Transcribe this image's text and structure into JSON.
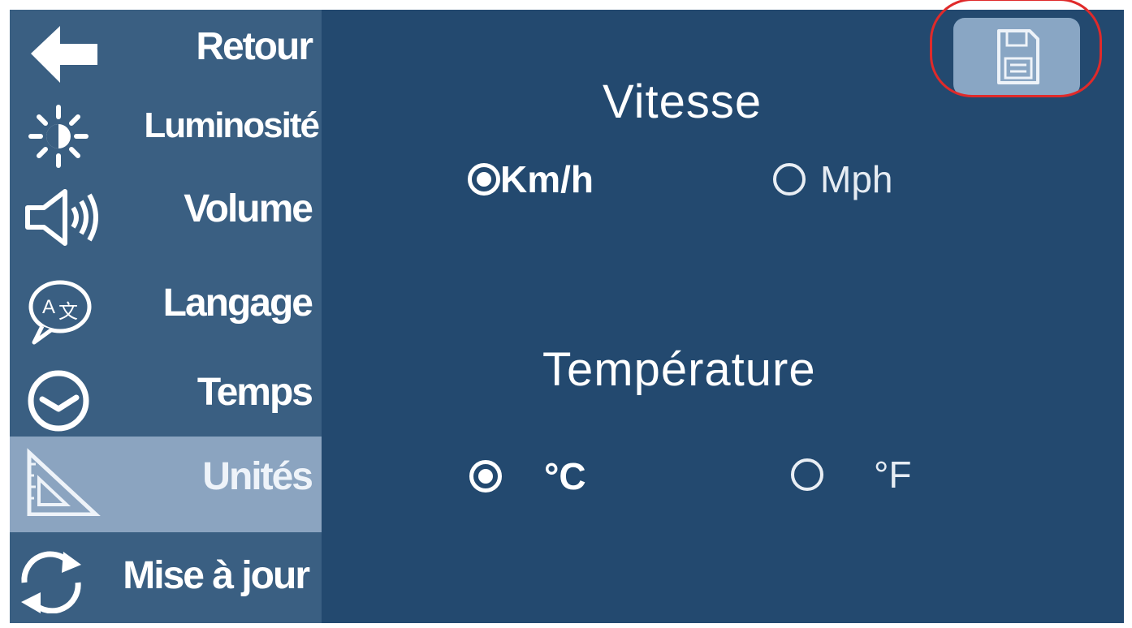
{
  "sidebar": {
    "items": [
      {
        "label": "Retour",
        "icon": "arrow-left-icon",
        "active": false
      },
      {
        "label": "Luminosité",
        "icon": "brightness-icon",
        "active": false
      },
      {
        "label": "Volume",
        "icon": "speaker-icon",
        "active": false
      },
      {
        "label": "Langage",
        "icon": "language-icon",
        "active": false
      },
      {
        "label": "Temps",
        "icon": "clock-icon",
        "active": false
      },
      {
        "label": "Unités",
        "icon": "triangle-ruler-icon",
        "active": true
      },
      {
        "label": "Mise à jour",
        "icon": "refresh-icon",
        "active": false
      }
    ]
  },
  "main": {
    "speed": {
      "title": "Vitesse",
      "options": [
        {
          "label": "Km/h",
          "selected": true
        },
        {
          "label": "Mph",
          "selected": false
        }
      ]
    },
    "temperature": {
      "title": "Température",
      "options": [
        {
          "label": "°C",
          "selected": true
        },
        {
          "label": "°F",
          "selected": false
        }
      ]
    }
  },
  "toolbar": {
    "save_icon": "floppy-disk-icon"
  },
  "colors": {
    "background": "#23496f",
    "sidebar": "#3a5f82",
    "active_item": "#8ba4c0",
    "save_button": "#89a6c4",
    "highlight": "#e02a2a"
  }
}
